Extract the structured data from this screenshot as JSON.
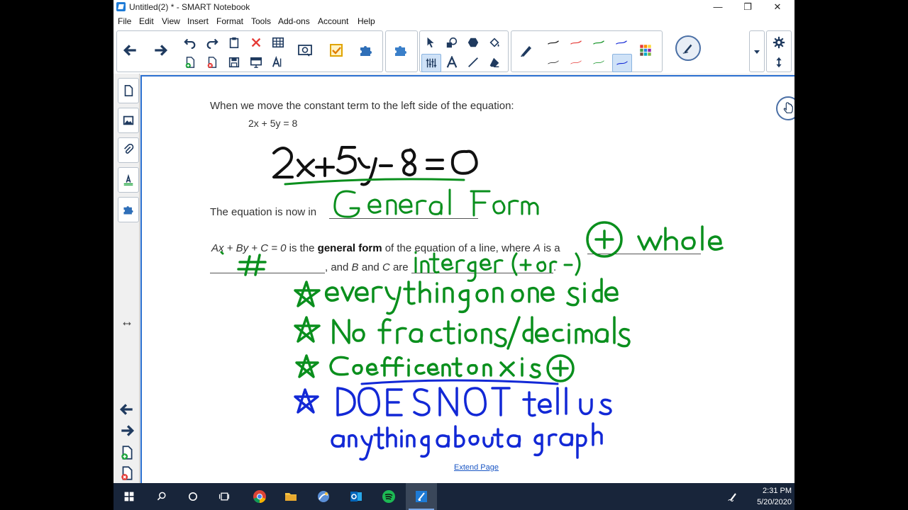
{
  "window": {
    "title": "Untitled(2) * - SMART Notebook",
    "minimize": "—",
    "restore": "❐",
    "close": "✕"
  },
  "menus": [
    "File",
    "Edit",
    "View",
    "Insert",
    "Format",
    "Tools",
    "Add-ons",
    "Account",
    "Help"
  ],
  "colors": {
    "ink_black": "#111111",
    "ink_green": "#0a8f1d",
    "ink_blue": "#1228d6",
    "ink_red": "#e53935",
    "accent": "#2a6fd0",
    "taskbar": "#18253a"
  },
  "page": {
    "line1": "When we move the constant term to the left side of the equation:",
    "equation": "2x + 5y = 8",
    "general_prefix": "The equation is now in",
    "def_formula": "Ax + By + C = 0",
    "def_is": "is the",
    "def_bold": "general form",
    "def_rest": "of the equation of a line, where",
    "def_A": "A",
    "def_is_a": "is a",
    "def_and": ", and",
    "def_B": "B",
    "def_and2": "and",
    "def_C": "C",
    "def_are": "are",
    "def_period": ".",
    "extend_link": "Extend Page"
  },
  "handwriting": {
    "equation": "2x+5y-8=0",
    "blank_general": "General Form",
    "blank_A_top": "(+) whole",
    "blank_A_bottom": "#",
    "blank_BC": "integer (+ or -)",
    "bullet1": "everything on one side",
    "bullet2": "No fractions/decimals",
    "bullet3": "Coeffcient on x is (+)",
    "bullet4": "DOES NOT tell us",
    "bullet4b": "anything about a graph"
  },
  "taskbar": {
    "time": "2:31 PM",
    "date": "5/20/2020"
  }
}
